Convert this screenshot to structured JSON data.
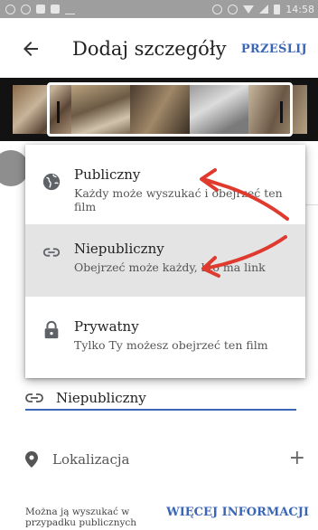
{
  "app_bar": {
    "title": "Dodaj szczegóły",
    "action_label": "PRZEŚLIJ"
  },
  "status_bar": {
    "time": "14:58"
  },
  "privacy_dialog": {
    "options": [
      {
        "title": "Publiczny",
        "description": "Każdy może wyszukać i obejrzeć ten film",
        "icon": "globe-icon",
        "selected": false
      },
      {
        "title": "Niepubliczny",
        "description": "Obejrzeć może każdy, kto ma link",
        "icon": "link-icon",
        "selected": true
      },
      {
        "title": "Prywatny",
        "description": "Tylko Ty możesz obejrzeć ten film",
        "icon": "lock-icon",
        "selected": false
      }
    ]
  },
  "privacy_field": {
    "value": "Niepubliczny",
    "icon": "link-icon"
  },
  "location": {
    "label": "Lokalizacja",
    "icon": "location-pin-icon",
    "add_icon": "plus-icon"
  },
  "footer": {
    "info_text": "Można ją wyszukać w przypadku publicznych",
    "more_info_label": "WIĘCEJ INFORMACJI"
  },
  "colors": {
    "accent": "#3a66b7",
    "annotation": "#e03a2f",
    "selected_row": "#e4e4e4"
  }
}
